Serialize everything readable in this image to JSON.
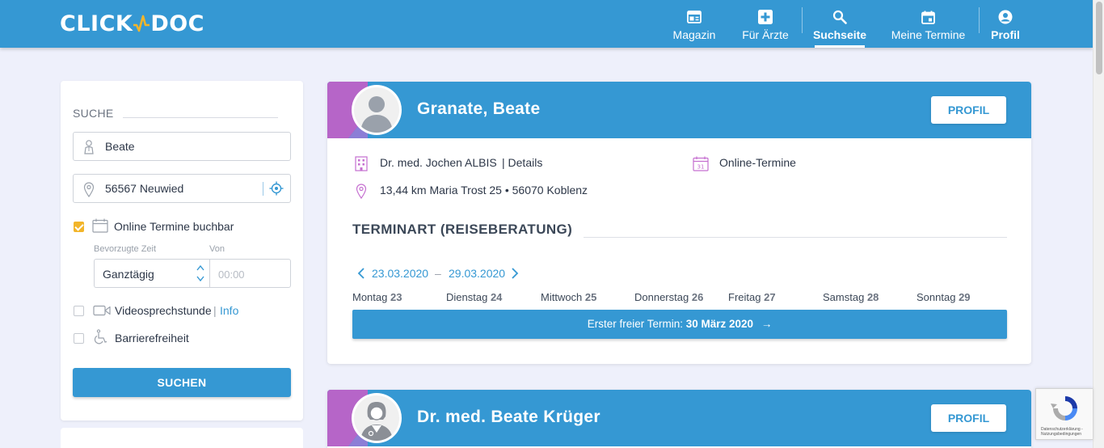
{
  "header": {
    "logo_left": "CLICK",
    "logo_right": "DOC",
    "nav": [
      {
        "label": "Magazin",
        "icon": "newspaper-icon"
      },
      {
        "label": "Für Ärzte",
        "icon": "medical-cross-icon"
      },
      {
        "label": "Suchseite",
        "icon": "search-icon",
        "active": true
      },
      {
        "label": "Meine Termine",
        "icon": "calendar-icon"
      },
      {
        "label": "Profil",
        "icon": "user-circle-icon"
      }
    ]
  },
  "sidebar": {
    "title": "SUCHE",
    "name_value": "Beate",
    "location_value": "56567 Neuwied",
    "online_label": "Online Termine buchbar",
    "online_checked": true,
    "preferred_time_label": "Bevorzugte Zeit",
    "from_label": "Von",
    "preferred_time_value": "Ganztägig",
    "from_placeholder": "00:00",
    "video_label": "Videosprechstunde",
    "video_separator": "|",
    "video_info": "Info",
    "video_checked": false,
    "accessibility_label": "Barrierefreiheit",
    "accessibility_checked": false,
    "search_button": "SUCHEN"
  },
  "results": [
    {
      "name": "Granate, Beate",
      "profile_button": "PROFIL",
      "practice": "Dr. med. Jochen ALBIS",
      "details_link": "| Details",
      "online_label": "Online-Termine",
      "distance": "13,44 km Maria Trost 25 • 56070 Koblenz",
      "appointment_type": "TERMINART (REISEBERATUNG)",
      "date_from": "23.03.2020",
      "date_sep": "–",
      "date_to": "29.03.2020",
      "days": [
        {
          "name": "Montag",
          "num": "23"
        },
        {
          "name": "Dienstag",
          "num": "24"
        },
        {
          "name": "Mittwoch",
          "num": "25"
        },
        {
          "name": "Donnerstag",
          "num": "26"
        },
        {
          "name": "Freitag",
          "num": "27"
        },
        {
          "name": "Samstag",
          "num": "28"
        },
        {
          "name": "Sonntag",
          "num": "29"
        }
      ],
      "first_free_prefix": "Erster freier Termin:",
      "first_free_date": "30 März 2020",
      "first_free_arrow": "→"
    },
    {
      "name": "Dr. med. Beate Krüger",
      "profile_button": "PROFIL"
    }
  ],
  "recaptcha": {
    "text": "Datenschutzerklärung - Nutzungsbedingungen"
  },
  "colors": {
    "primary": "#3598d3",
    "accent_purple": "#b665c8",
    "checkbox": "#f2b52a",
    "background": "#eef0fb"
  }
}
